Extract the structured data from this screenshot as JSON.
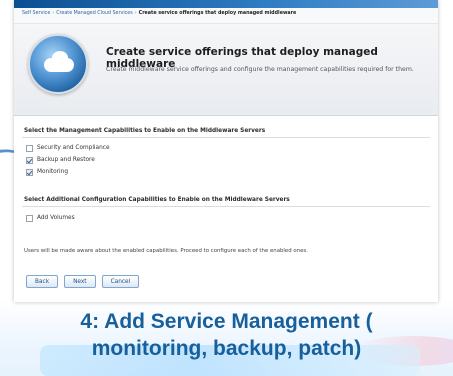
{
  "breadcrumb": {
    "crumb1": "Self Service",
    "crumb2": "Create Managed Cloud Services",
    "current": "Create service offerings that deploy managed middleware"
  },
  "header": {
    "title": "Create service offerings that deploy managed middleware",
    "description": "Create middleware service offerings and configure the management capabilities required for them."
  },
  "management": {
    "title": "Select the Management Capabilities to Enable on the Middleware Servers",
    "options": [
      {
        "label": "Security and Compliance",
        "checked": false
      },
      {
        "label": "Backup and Restore",
        "checked": true
      },
      {
        "label": "Monitoring",
        "checked": true
      }
    ]
  },
  "additional": {
    "title": "Select Additional Configuration Capabilities to Enable on the Middleware Servers",
    "options": [
      {
        "label": "Add Volumes",
        "checked": false
      }
    ]
  },
  "note": "Users will be made aware about the enabled capabilities. Proceed to configure each of the enabled ones.",
  "buttons": {
    "back": "Back",
    "next": "Next",
    "cancel": "Cancel"
  },
  "caption": {
    "line1": "4: Add Service Management (",
    "line2": "monitoring, backup, patch)"
  },
  "colors": {
    "caption": "#17609c",
    "topbar": "#0b4f91",
    "link": "#2a63a8"
  },
  "icons": {
    "header": "cloud-service-icon",
    "checkbox": "checkbox-icon"
  }
}
